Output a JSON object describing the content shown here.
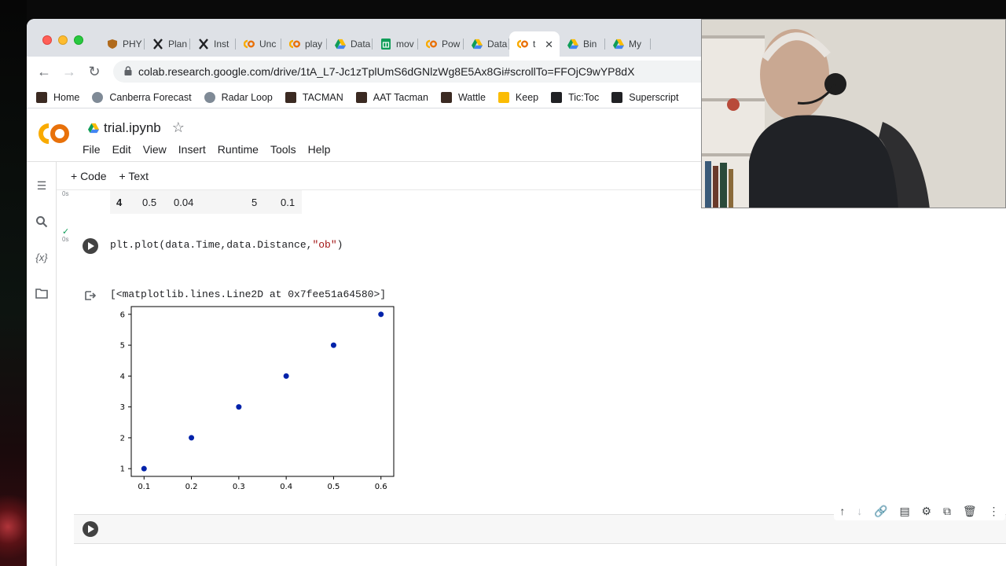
{
  "browser": {
    "tabs": [
      {
        "label": "PHY",
        "icon": "shield-icon",
        "color": "#b06a1c"
      },
      {
        "label": "Plan",
        "icon": "x-icon",
        "color": "#202124"
      },
      {
        "label": "Inst",
        "icon": "x-icon",
        "color": "#202124"
      },
      {
        "label": "Unc",
        "icon": "colab-icon",
        "color": "#f9ab00"
      },
      {
        "label": "play",
        "icon": "colab-icon",
        "color": "#f9ab00"
      },
      {
        "label": "Data",
        "icon": "drive-icon",
        "color": "#1a73e8"
      },
      {
        "label": "mov",
        "icon": "sheets-icon",
        "color": "#0f9d58"
      },
      {
        "label": "Pow",
        "icon": "colab-icon",
        "color": "#f9ab00"
      },
      {
        "label": "Data",
        "icon": "drive-icon",
        "color": "#1a73e8"
      },
      {
        "label": "t",
        "icon": "colab-icon",
        "color": "#f9ab00",
        "active": true
      },
      {
        "label": "Bin",
        "icon": "drive-icon",
        "color": "#1a73e8"
      },
      {
        "label": "My",
        "icon": "drive-icon",
        "color": "#1a73e8"
      }
    ],
    "tab_close": "✕",
    "url": "colab.research.google.com/drive/1tA_L7-Jc1zTplUmS6dGNlzWg8E5Ax8Gi#scrollTo=FFOjC9wYP8dX",
    "bookmarks": [
      {
        "label": "Home",
        "color": "#3b2a22"
      },
      {
        "label": "Canberra Forecast",
        "color": "#7f8a96"
      },
      {
        "label": "Radar Loop",
        "color": "#7f8a96"
      },
      {
        "label": "TACMAN",
        "color": "#3b2a22"
      },
      {
        "label": "AAT Tacman",
        "color": "#3b2a22"
      },
      {
        "label": "Wattle",
        "color": "#3b2a22"
      },
      {
        "label": "Keep",
        "color": "#fbbc04"
      },
      {
        "label": "Tic:Toc",
        "color": "#202124"
      },
      {
        "label": "Superscript",
        "color": "#202124"
      }
    ]
  },
  "colab": {
    "notebook_title": "trial.ipynb",
    "menu": [
      "File",
      "Edit",
      "View",
      "Insert",
      "Runtime",
      "Tools",
      "Help"
    ],
    "toolbar": {
      "code": "+ Code",
      "text": "+ Text"
    },
    "df_row": {
      "index": "4",
      "time": "0.5",
      "c2": "0.04",
      "c3": "5",
      "c4": "0.1"
    },
    "code_cell": {
      "prefix": "plt.plot(data.Time,data.Distance,",
      "string": "\"ob\"",
      "suffix": ")",
      "exec_time": "0s",
      "status": "✓"
    },
    "output_text": "[<matplotlib.lines.Line2D at 0x7fee51a64580>]",
    "side_top_secs": "0s"
  },
  "chart_data": {
    "type": "scatter",
    "x": [
      0.1,
      0.2,
      0.3,
      0.4,
      0.5,
      0.6
    ],
    "y": [
      1,
      2,
      3,
      4,
      5,
      6
    ],
    "xticks": [
      "0.1",
      "0.2",
      "0.3",
      "0.4",
      "0.5",
      "0.6"
    ],
    "yticks": [
      "1",
      "2",
      "3",
      "4",
      "5",
      "6"
    ],
    "xlim": [
      0.073,
      0.627
    ],
    "ylim": [
      0.75,
      6.25
    ],
    "marker_color": "#0022aa",
    "title": "",
    "xlabel": "",
    "ylabel": ""
  }
}
